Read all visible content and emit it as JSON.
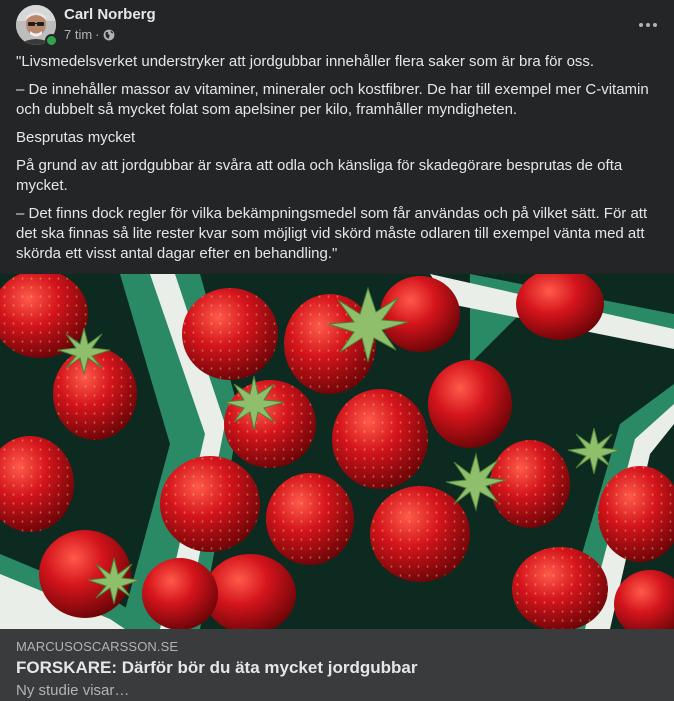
{
  "post": {
    "author": "Carl Norberg",
    "time": "7 tim",
    "separator": "·",
    "privacy_icon": "globe-icon",
    "more_icon": "more-horizontal-icon",
    "paragraphs": [
      "\"Livsmedelsverket understryker att jordgubbar innehåller flera saker som är bra för oss.",
      "– De innehåller massor av vitaminer, mineraler och kostfibrer. De har till exempel mer C-vitamin och dubbelt så mycket folat som apelsiner per kilo, framhåller myndigheten.",
      "Besprutas mycket",
      "På grund av att jordgubbar är svåra att odla och känsliga för skadegörare besprutas de ofta mycket.",
      "– Det finns dock regler för vilka bekämpningsmedel som får användas och på vilket sätt. För att det ska finnas så lite rester kvar som möjligt vid skörd måste odlaren till exempel vänta med att skörda ett visst antal dagar efter en behandling.\""
    ]
  },
  "link_preview": {
    "domain": "MARCUSOSCARSSON.SE",
    "title": "FORSKARE: Därför bör du äta mycket jordgubbar",
    "description": "Ny studie visar…"
  },
  "colors": {
    "card_background": "#242526",
    "preview_background": "#3a3b3c",
    "primary_text": "#e4e6eb",
    "secondary_text": "#b0b3b8",
    "online": "#31a24c",
    "strawberry": "#c8111a",
    "basket": "#1f7a5a"
  }
}
